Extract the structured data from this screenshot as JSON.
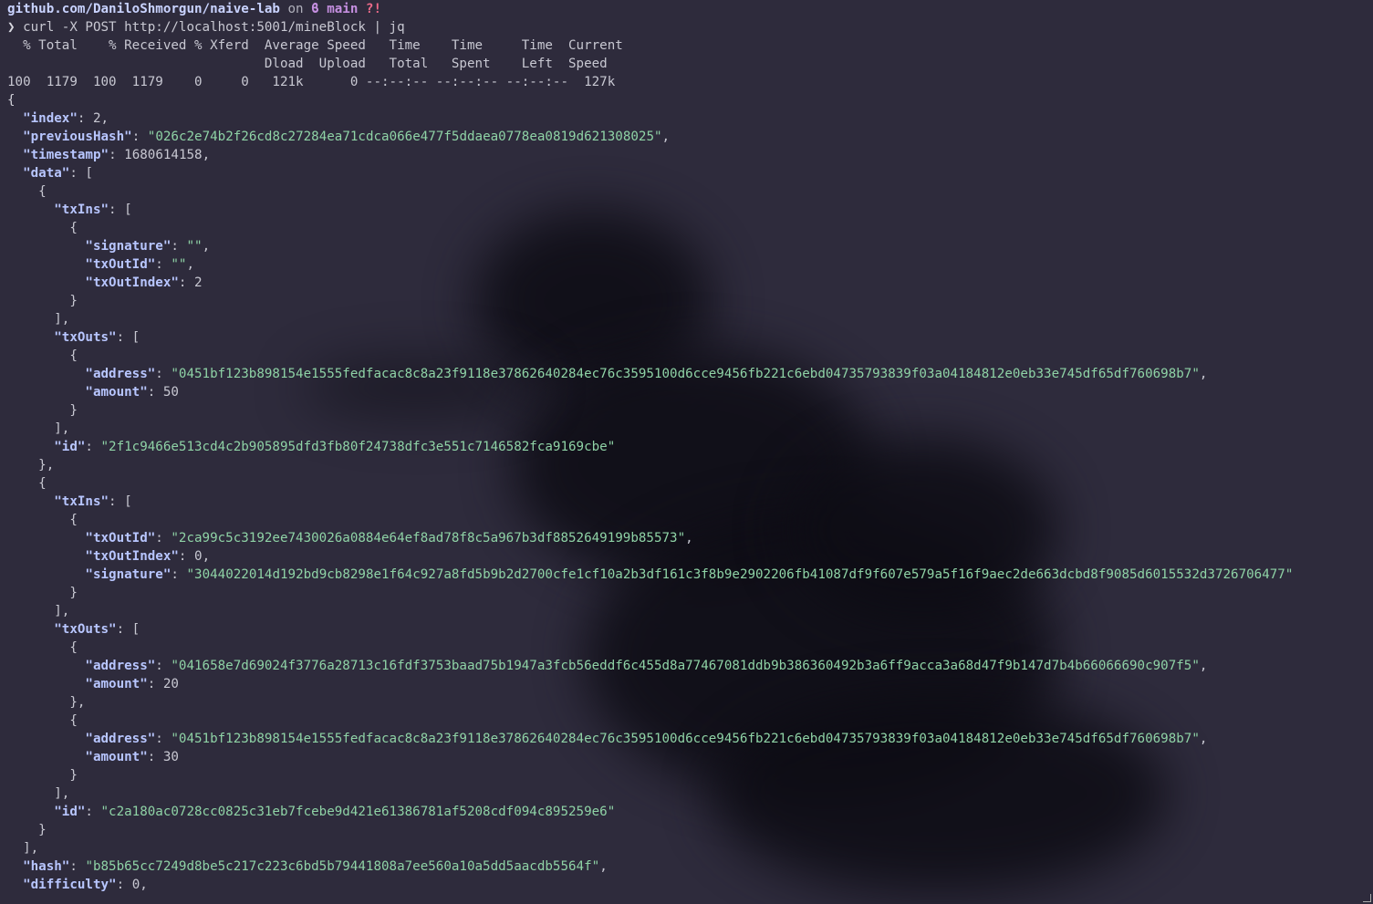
{
  "prompt_line": {
    "repo": "github.com/DaniloShmorgun/naive-lab",
    "on_word": " on ",
    "branch_icon_and_name": "ϐ main",
    "status": " ?!"
  },
  "command_line": {
    "prompt_symbol": "❯",
    "command": "curl -X POST http://localhost:5001/mineBlock | jq"
  },
  "curl_progress": {
    "header1": "  % Total    % Received % Xferd  Average Speed   Time    Time     Time  Current",
    "header2": "                                 Dload  Upload   Total   Spent    Left  Speed",
    "row": "100  1179  100  1179    0     0   121k      0 --:--:-- --:--:-- --:--:--  127k"
  },
  "json_output": {
    "index": "2",
    "previousHash": "\"026c2e74b2f26cd8c27284ea71cdca066e477f5ddaea0778ea0819d621308025\"",
    "timestamp": "1680614158",
    "tx1_signature": "\"\"",
    "tx1_txOutId": "\"\"",
    "tx1_txOutIndex": "2",
    "tx1_out_address": "\"0451bf123b898154e1555fedfacac8c8a23f9118e37862640284ec76c3595100d6cce9456fb221c6ebd04735793839f03a04184812e0eb33e745df65df760698b7\"",
    "tx1_out_amount": "50",
    "tx1_id": "\"2f1c9466e513cd4c2b905895dfd3fb80f24738dfc3e551c7146582fca9169cbe\"",
    "tx2_txOutId": "\"2ca99c5c3192ee7430026a0884e64ef8ad78f8c5a967b3df8852649199b85573\"",
    "tx2_txOutIndex": "0",
    "tx2_signature": "\"3044022014d192bd9cb8298e1f64c927a8fd5b9b2d2700cfe1cf10a2b3df161c3f8b9e2902206fb41087df9f607e579a5f16f9aec2de663dcbd8f9085d6015532d3726706477\"",
    "tx2_out1_address": "\"041658e7d69024f3776a28713c16fdf3753baad75b1947a3fcb56eddf6c455d8a77467081ddb9b386360492b3a6ff9acca3a68d47f9b147d7b4b66066690c907f5\"",
    "tx2_out1_amount": "20",
    "tx2_out2_address": "\"0451bf123b898154e1555fedfacac8c8a23f9118e37862640284ec76c3595100d6cce9456fb221c6ebd04735793839f03a04184812e0eb33e745df65df760698b7\"",
    "tx2_out2_amount": "30",
    "tx2_id": "\"c2a180ac0728cc0825c31eb7fcebe9d421e61386781af5208cdf094c895259e6\"",
    "hash": "\"b85b65cc7249d8be5c217c223c6bd5b79441808a7ee560a10a5dd5aacdb5564f\"",
    "difficulty": "0"
  },
  "keys": {
    "index": "\"index\"",
    "previousHash": "\"previousHash\"",
    "timestamp": "\"timestamp\"",
    "data": "\"data\"",
    "txIns": "\"txIns\"",
    "signature": "\"signature\"",
    "txOutId": "\"txOutId\"",
    "txOutIndex": "\"txOutIndex\"",
    "txOuts": "\"txOuts\"",
    "address": "\"address\"",
    "amount": "\"amount\"",
    "id": "\"id\"",
    "hash": "\"hash\"",
    "difficulty": "\"difficulty\""
  },
  "colors": {
    "background": "#2e2b3c",
    "key": "#b8c6ff",
    "string": "#8fd3a6",
    "branch": "#c58fe0",
    "status": "#ef6b8a"
  }
}
